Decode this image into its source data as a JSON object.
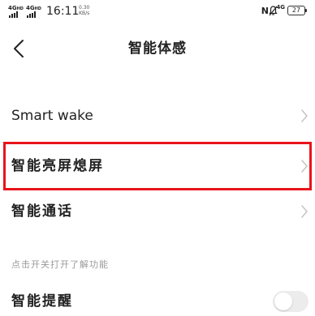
{
  "status_bar": {
    "network1": "4G",
    "network2": "4G",
    "hd": "HD",
    "time": "16:11",
    "speed_value": "0.30",
    "speed_unit": "KB/s",
    "nfc": "N",
    "network_right": "4G",
    "battery": "27"
  },
  "header": {
    "title": "智能体感"
  },
  "settings": {
    "smart_wake": "Smart wake",
    "smart_screen": "智能亮屏熄屏",
    "smart_call": "智能通话",
    "section_hint": "点击开关打开了解功能",
    "smart_reminder": "智能提醒"
  },
  "toggles": {
    "smart_reminder_on": false
  },
  "colors": {
    "highlight": "#e8141b",
    "chevron": "#c4c4c4",
    "hint": "#9a9a9a"
  }
}
